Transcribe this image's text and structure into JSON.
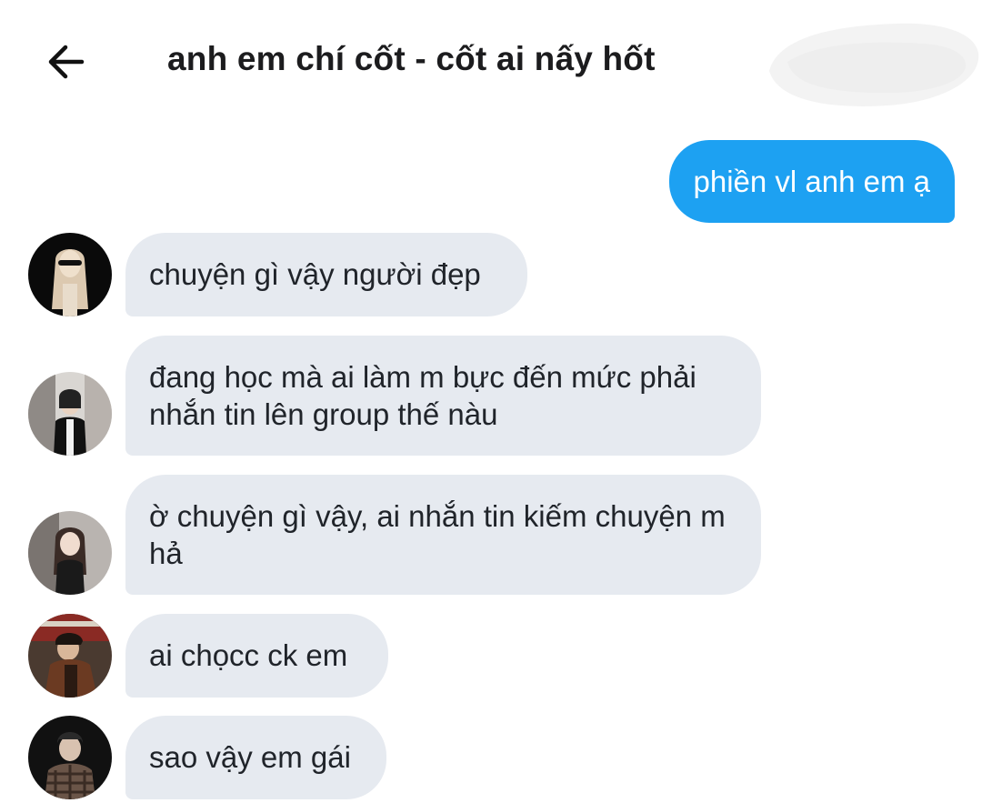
{
  "header": {
    "title": "anh em chí cốt - cốt ai nấy hốt",
    "back_icon": "arrow-left-icon"
  },
  "colors": {
    "outgoing_bubble": "#1da1f2",
    "incoming_bubble": "#e6eaf0",
    "background": "#ffffff"
  },
  "messages": [
    {
      "direction": "outgoing",
      "text": "phiền vl anh em ạ"
    },
    {
      "direction": "incoming",
      "text": "chuyện gì vậy người đẹp"
    },
    {
      "direction": "incoming",
      "text": "đang học mà ai làm m bực đến mức phải nhắn tin lên group thế nàu"
    },
    {
      "direction": "incoming",
      "text": "ờ chuyện gì vậy, ai nhắn tin kiếm chuyện m hả"
    },
    {
      "direction": "incoming",
      "text": "ai chọcc ck em"
    },
    {
      "direction": "incoming",
      "text": "sao vậy em gái"
    }
  ]
}
